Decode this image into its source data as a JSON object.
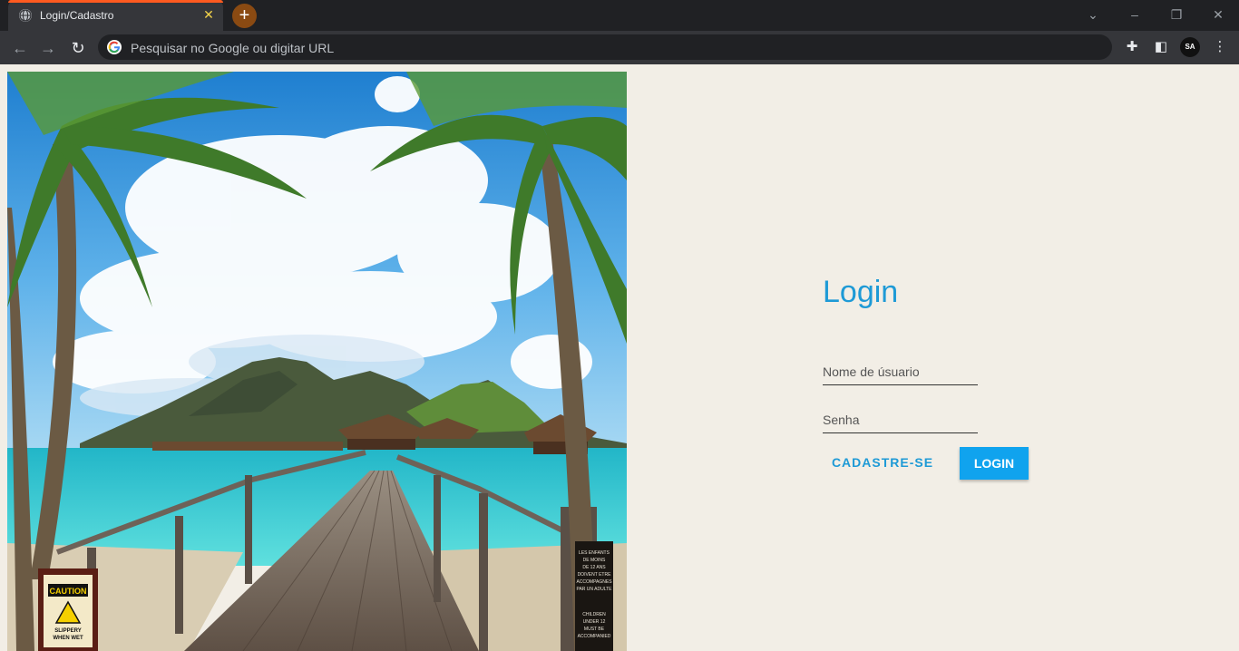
{
  "browser": {
    "tab_title": "Login/Cadastro",
    "tab_close": "✕",
    "new_tab": "+",
    "address_placeholder": "Pesquisar no Google ou digitar URL",
    "profile_initials": "SA"
  },
  "hero": {
    "image_description_icon": "landscape-image",
    "caution_sign_text": "CAUTION",
    "caution_sign_subtext": "SLIPPERY WHEN WET",
    "kids_sign_text": "LES ENFANTS DE MOINS DE 12 ANS DOIVENT ETRE ACCOMPAGNES PAR UN ADULTE",
    "kids_sign_english": "CHILDREN UNDER 12 MUST BE ACCOMPANIED"
  },
  "login": {
    "title": "Login",
    "username_placeholder": "Nome de úsuario",
    "password_placeholder": "Senha",
    "register_label": "CADASTRE-SE",
    "login_label": "LOGIN"
  },
  "colors": {
    "accent": "#1e9ad6",
    "login_button": "#10a3ee",
    "page_background": "#f2eee6"
  }
}
